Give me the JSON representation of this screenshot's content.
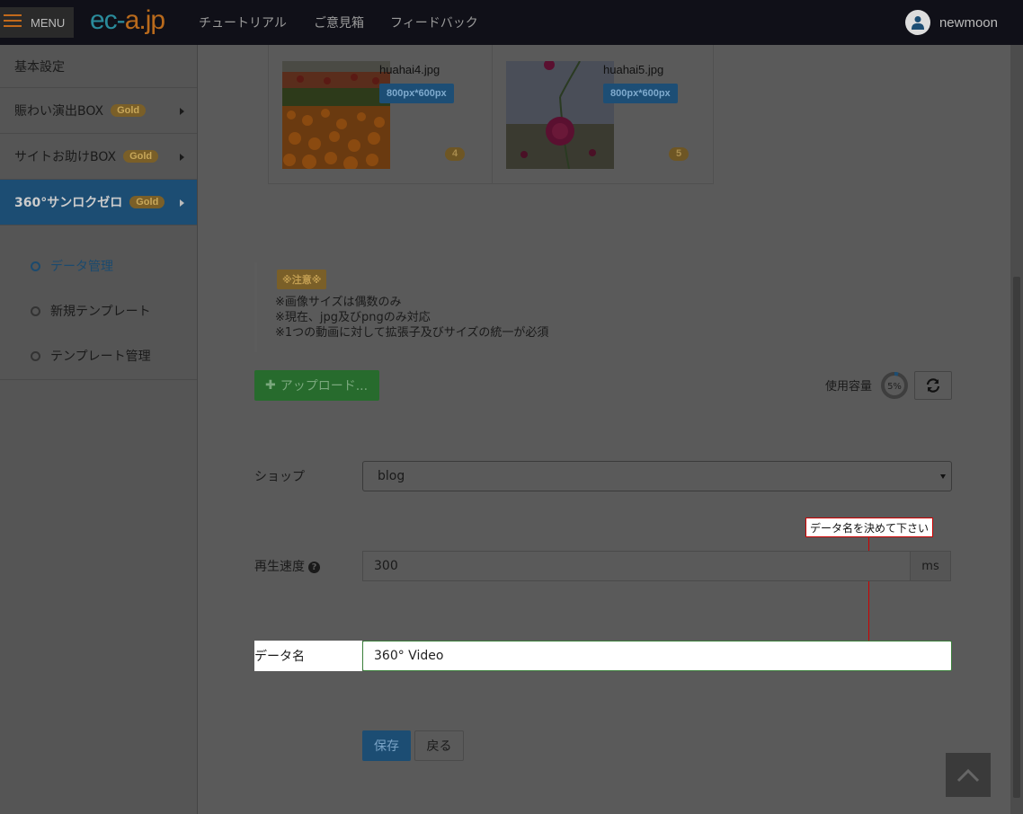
{
  "topbar": {
    "menu_label": "MENU",
    "logo_part1": "ec-",
    "logo_part2": "a.jp",
    "nav": [
      "チュートリアル",
      "ご意見箱",
      "フィードバック"
    ],
    "username": "newmoon"
  },
  "sidebar": {
    "items": [
      {
        "label": "基本設定"
      },
      {
        "label": "賑わい演出BOX",
        "badge": "Gold"
      },
      {
        "label": "サイトお助けBOX",
        "badge": "Gold"
      },
      {
        "label": "360°サンロクゼロ",
        "badge": "Gold"
      }
    ],
    "subitems": [
      "データ管理",
      "新規テンプレート",
      "テンプレート管理"
    ]
  },
  "images": [
    {
      "filename": "huahai4.jpg",
      "size": "800px*600px",
      "number": "4"
    },
    {
      "filename": "huahai5.jpg",
      "size": "800px*600px",
      "number": "5"
    }
  ],
  "notice": {
    "tag": "※注意※",
    "lines": [
      "※画像サイズは偶数のみ",
      "※現在、jpg及びpngのみ対応",
      "※1つの動画に対して拡張子及びサイズの統一が必須"
    ]
  },
  "upload": {
    "label": "アップロード..."
  },
  "usage": {
    "label": "使用容量",
    "percent_text": "5%",
    "percent": 5
  },
  "form": {
    "shop_label": "ショップ",
    "shop_value": "blog",
    "speed_label": "再生速度",
    "speed_value": "300",
    "speed_unit": "ms",
    "name_label": "データ名",
    "name_value": "360° Video",
    "tooltip": "データ名を決めて下さい"
  },
  "buttons": {
    "save": "保存",
    "back": "戻る"
  },
  "colors": {
    "accent_blue": "#1c4d73",
    "gold": "#7a5f28",
    "green": "#276b2d",
    "error_red": "#cc0000"
  }
}
